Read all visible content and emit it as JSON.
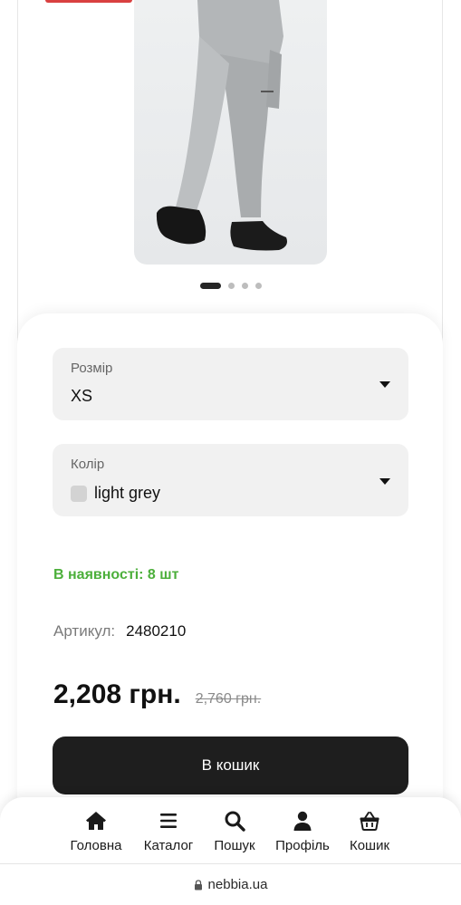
{
  "product": {
    "image_alt": "grey leggings on model",
    "gallery_dots": {
      "count": 4,
      "active_index": 0
    }
  },
  "size_select": {
    "label": "Розмір",
    "value": "XS"
  },
  "color_select": {
    "label": "Колір",
    "value": "light grey",
    "swatch_color": "#d3d3d3"
  },
  "stock": {
    "text": "В наявності: 8 шт",
    "color": "#4caf3b"
  },
  "sku": {
    "label": "Артикул:",
    "value": "2480210"
  },
  "price": {
    "current": "2,208 грн.",
    "old": "2,760 грн."
  },
  "cart_button": {
    "label": "В кошик"
  },
  "nav": {
    "items": [
      {
        "label": "Головна",
        "icon": "home-icon"
      },
      {
        "label": "Каталог",
        "icon": "menu-icon"
      },
      {
        "label": "Пошук",
        "icon": "search-icon"
      },
      {
        "label": "Профіль",
        "icon": "user-icon"
      },
      {
        "label": "Кошик",
        "icon": "basket-icon"
      }
    ]
  },
  "browser": {
    "url": "nebbia.ua"
  },
  "colors": {
    "accent": "#1e1e1e",
    "sale": "#d94040",
    "in_stock": "#4caf3b"
  }
}
